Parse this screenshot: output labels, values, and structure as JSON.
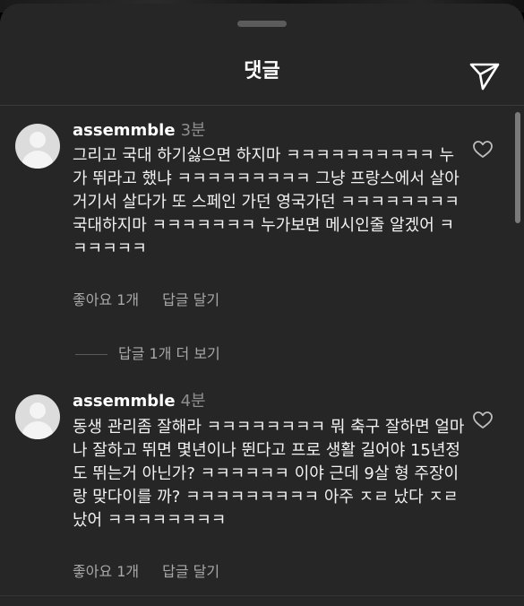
{
  "header": {
    "title": "댓글"
  },
  "comments": [
    {
      "username": "assemmble",
      "time": "3분",
      "text": "그리고 국대 하기싫으면 하지마 ㅋㅋㅋㅋㅋㅋㅋㅋㅋㅋ 누가 뛰라고 했냐 ㅋㅋㅋㅋㅋㅋㅋㅋㅋ 그냥 프랑스에서 살아 거기서 살다가 또 스페인 가던 영국가던 ㅋㅋㅋㅋㅋㅋㅋㅋ 국대하지마  ㅋㅋㅋㅋㅋㅋㅋ 누가보면 메시인줄 알겠어 ㅋㅋㅋㅋㅋㅋ",
      "likes": "좋아요 1개",
      "reply": "답글 달기"
    },
    {
      "username": "assemmble",
      "time": "4분",
      "text": "동생 관리좀 잘해라 ㅋㅋㅋㅋㅋㅋㅋㅋ 뭐 축구 잘하면 얼마나 잘하고 뛰면 몇년이나 뛴다고 프로 생활 길어야 15년정도 뛰는거 아닌가? ㅋㅋㅋㅋㅋㅋ 이야 근데 9살 형 주장이랑 맞다이를 까? ㅋㅋㅋㅋㅋㅋㅋㅋㅋ 아주 ㅈㄹ 났다 ㅈㄹ 났어 ㅋㅋㅋㅋㅋㅋㅋㅋ",
      "likes": "좋아요 1개",
      "reply": "답글 달기"
    }
  ],
  "view_replies": "답글 1개 더 보기"
}
